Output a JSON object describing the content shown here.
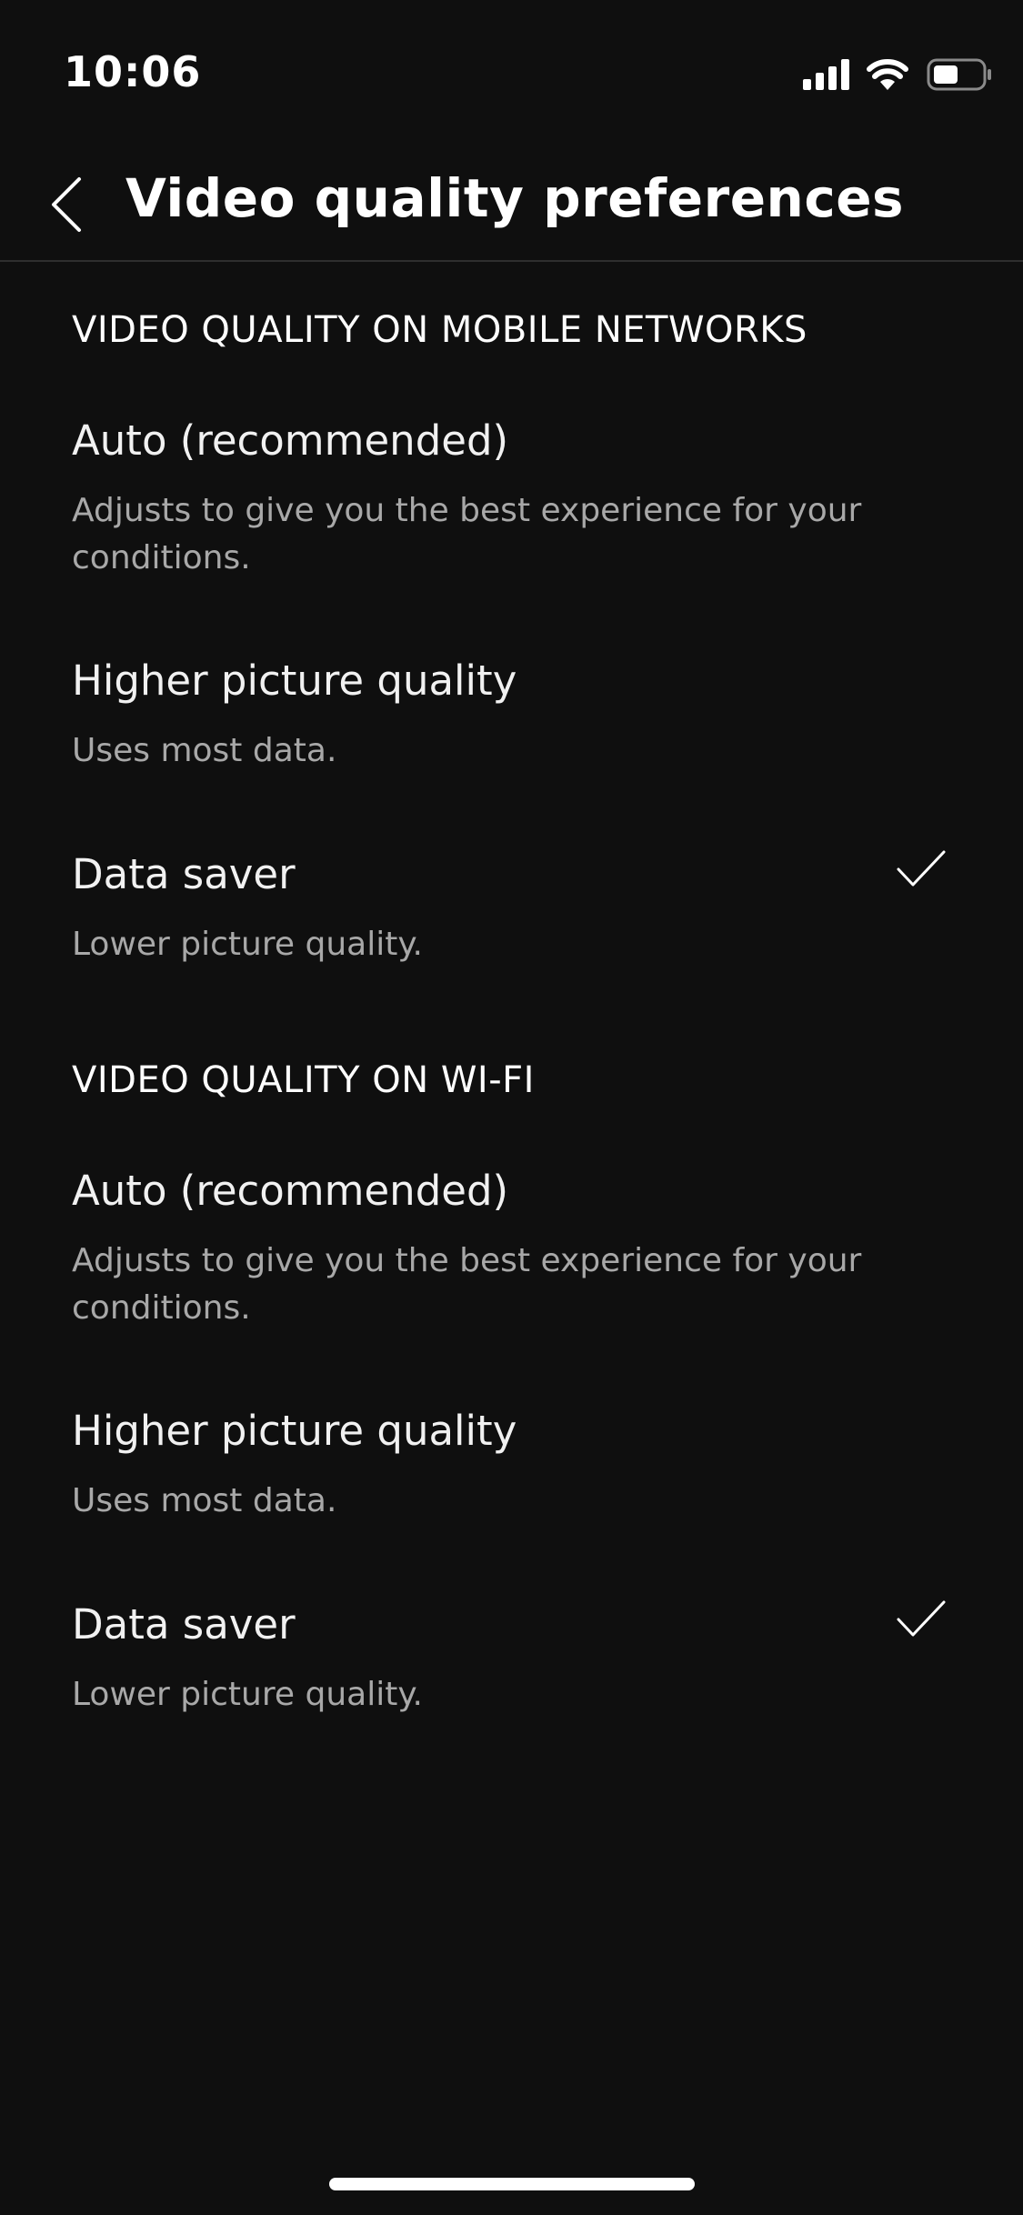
{
  "status_bar": {
    "time": "10:06",
    "icons": [
      "signal-icon",
      "wifi-icon",
      "battery-icon"
    ]
  },
  "header": {
    "back_icon": "chevron-left-icon",
    "title": "Video quality preferences"
  },
  "sections": [
    {
      "title": "VIDEO QUALITY ON MOBILE NETWORKS",
      "options": [
        {
          "label": "Auto (recommended)",
          "description": "Adjusts to give you the best experience for your conditions.",
          "selected": false
        },
        {
          "label": "Higher picture quality",
          "description": "Uses most data.",
          "selected": false
        },
        {
          "label": "Data saver",
          "description": "Lower picture quality.",
          "selected": true
        }
      ]
    },
    {
      "title": "VIDEO QUALITY ON WI-FI",
      "options": [
        {
          "label": "Auto (recommended)",
          "description": "Adjusts to give you the best experience for your conditions.",
          "selected": false
        },
        {
          "label": "Higher picture quality",
          "description": "Uses most data.",
          "selected": false
        },
        {
          "label": "Data saver",
          "description": "Lower picture quality.",
          "selected": true
        }
      ]
    }
  ],
  "colors": {
    "background": "#0f0f0f",
    "text_primary": "#f1f1f1",
    "text_secondary": "#a8a8a8"
  }
}
